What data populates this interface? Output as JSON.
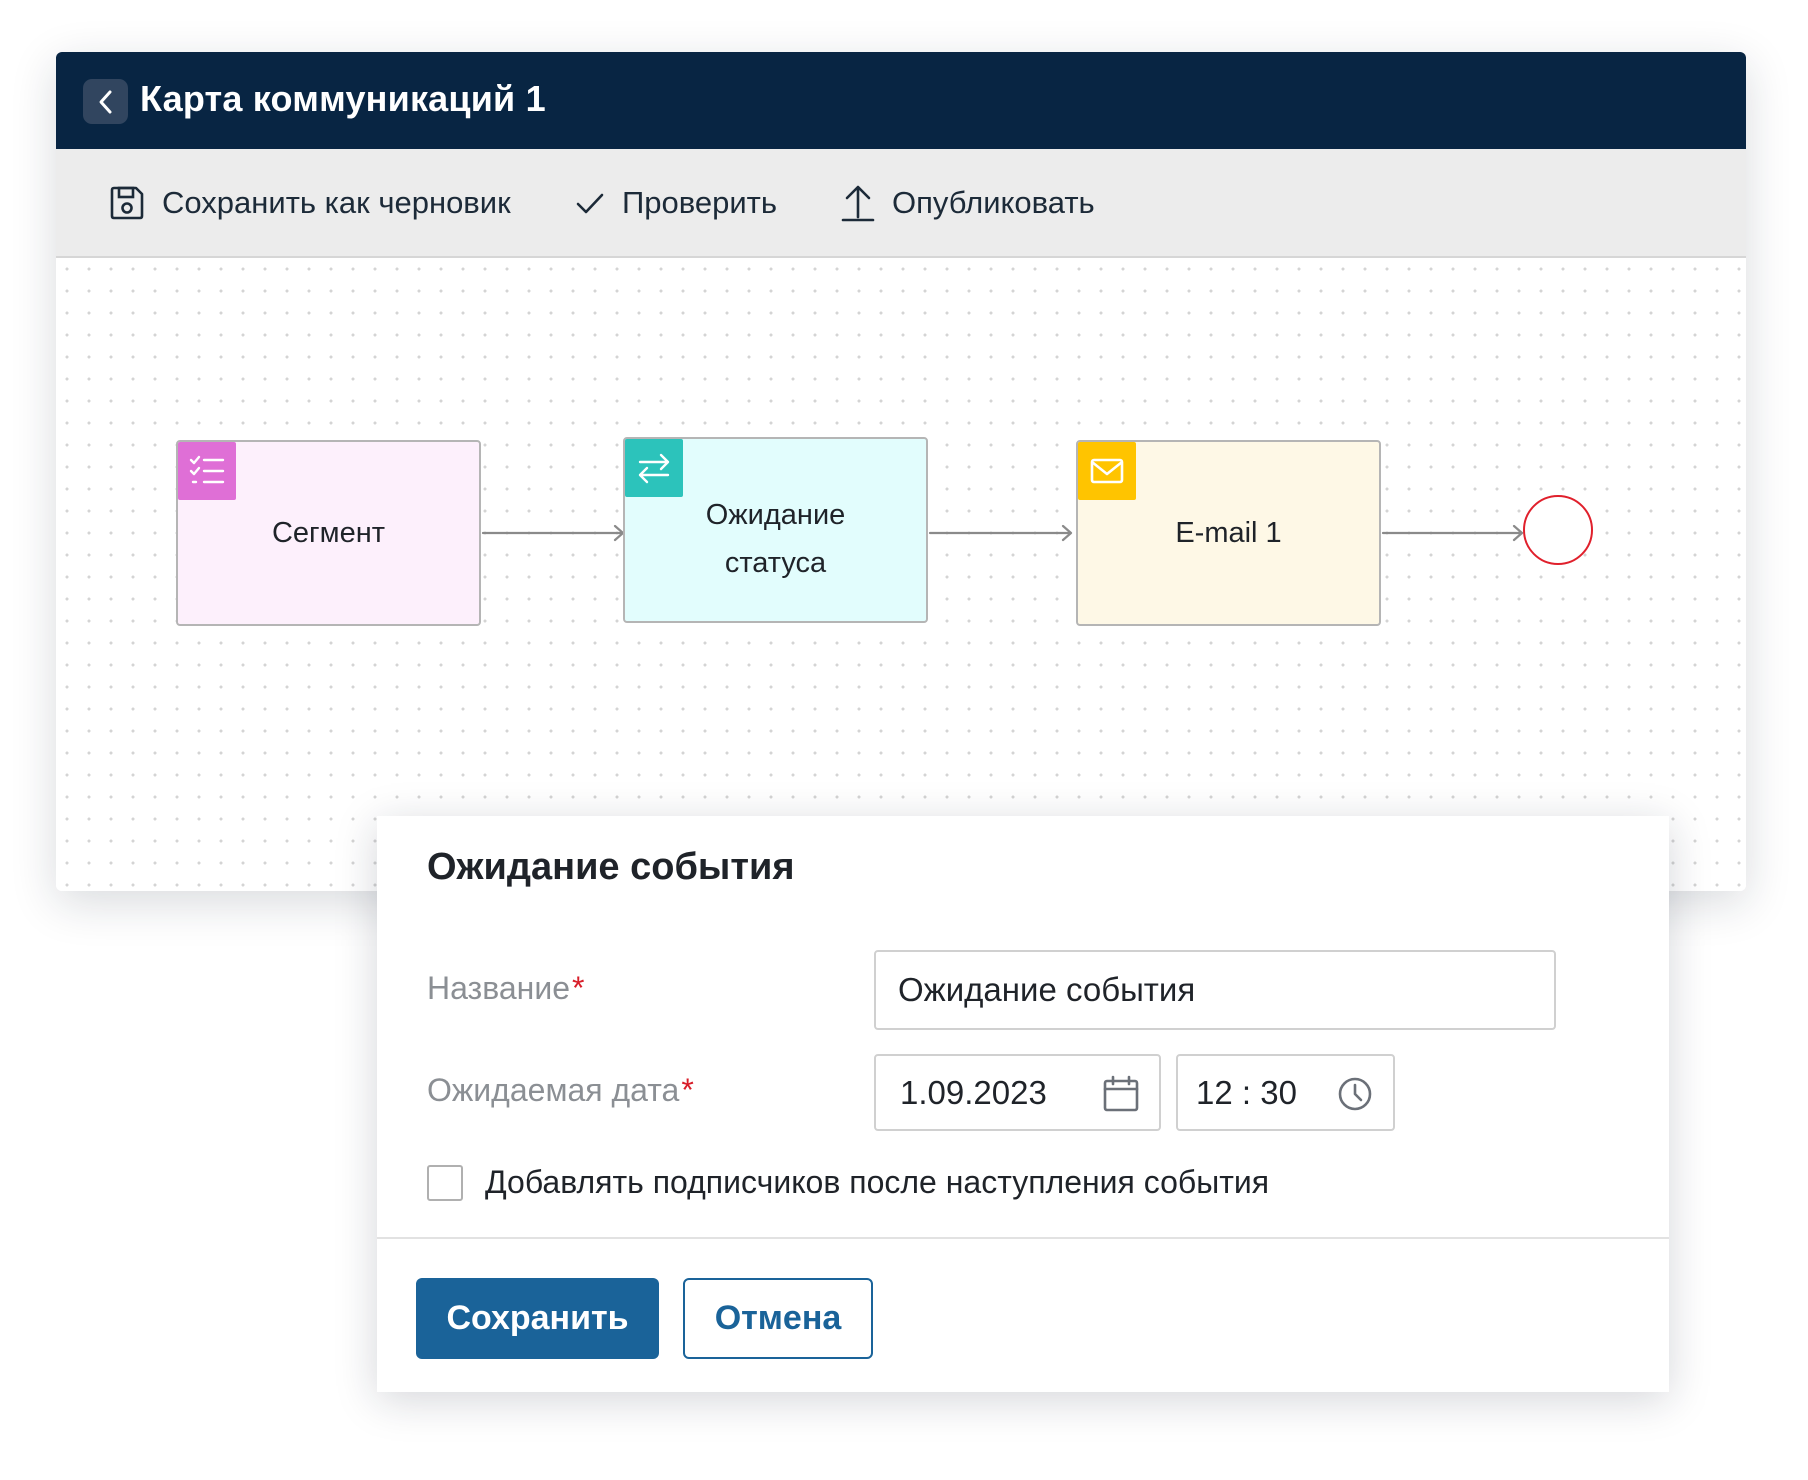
{
  "window": {
    "title": "Карта коммуникаций 1"
  },
  "toolbar": {
    "save_draft": "Сохранить как черновик",
    "check": "Проверить",
    "publish": "Опубликовать"
  },
  "flow": {
    "nodes": [
      {
        "label": "Сегмент",
        "icon": "checklist-icon",
        "color": "#df6fd6"
      },
      {
        "label": "Ожидание статуса",
        "icon": "swap-arrows-icon",
        "color": "#2cc3bb"
      },
      {
        "label": "E-mail 1",
        "icon": "envelope-icon",
        "color": "#ffc400"
      }
    ],
    "end_color": "#e0202c"
  },
  "dialog": {
    "title": "Ожидание события",
    "name_label": "Название",
    "name_value": "Ожидание события",
    "date_label": "Ожидаемая дата",
    "date_value": "1.09.2023",
    "time_value": "12 : 30",
    "required_mark": "*",
    "checkbox_label": "Добавлять подписчиков после наступления события",
    "save_button": "Сохранить",
    "cancel_button": "Отмена"
  },
  "colors": {
    "header_bg": "#082543",
    "primary": "#1a6399",
    "required": "#d81e2a"
  }
}
